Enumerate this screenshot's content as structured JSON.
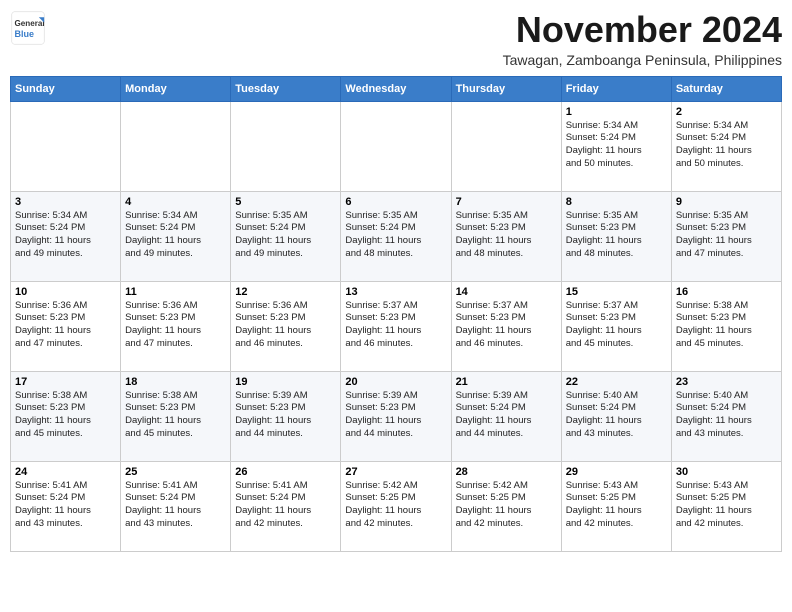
{
  "header": {
    "logo_line1": "General",
    "logo_line2": "Blue",
    "month": "November 2024",
    "location": "Tawagan, Zamboanga Peninsula, Philippines"
  },
  "weekdays": [
    "Sunday",
    "Monday",
    "Tuesday",
    "Wednesday",
    "Thursday",
    "Friday",
    "Saturday"
  ],
  "weeks": [
    [
      {
        "day": "",
        "info": ""
      },
      {
        "day": "",
        "info": ""
      },
      {
        "day": "",
        "info": ""
      },
      {
        "day": "",
        "info": ""
      },
      {
        "day": "",
        "info": ""
      },
      {
        "day": "1",
        "info": "Sunrise: 5:34 AM\nSunset: 5:24 PM\nDaylight: 11 hours\nand 50 minutes."
      },
      {
        "day": "2",
        "info": "Sunrise: 5:34 AM\nSunset: 5:24 PM\nDaylight: 11 hours\nand 50 minutes."
      }
    ],
    [
      {
        "day": "3",
        "info": "Sunrise: 5:34 AM\nSunset: 5:24 PM\nDaylight: 11 hours\nand 49 minutes."
      },
      {
        "day": "4",
        "info": "Sunrise: 5:34 AM\nSunset: 5:24 PM\nDaylight: 11 hours\nand 49 minutes."
      },
      {
        "day": "5",
        "info": "Sunrise: 5:35 AM\nSunset: 5:24 PM\nDaylight: 11 hours\nand 49 minutes."
      },
      {
        "day": "6",
        "info": "Sunrise: 5:35 AM\nSunset: 5:24 PM\nDaylight: 11 hours\nand 48 minutes."
      },
      {
        "day": "7",
        "info": "Sunrise: 5:35 AM\nSunset: 5:23 PM\nDaylight: 11 hours\nand 48 minutes."
      },
      {
        "day": "8",
        "info": "Sunrise: 5:35 AM\nSunset: 5:23 PM\nDaylight: 11 hours\nand 48 minutes."
      },
      {
        "day": "9",
        "info": "Sunrise: 5:35 AM\nSunset: 5:23 PM\nDaylight: 11 hours\nand 47 minutes."
      }
    ],
    [
      {
        "day": "10",
        "info": "Sunrise: 5:36 AM\nSunset: 5:23 PM\nDaylight: 11 hours\nand 47 minutes."
      },
      {
        "day": "11",
        "info": "Sunrise: 5:36 AM\nSunset: 5:23 PM\nDaylight: 11 hours\nand 47 minutes."
      },
      {
        "day": "12",
        "info": "Sunrise: 5:36 AM\nSunset: 5:23 PM\nDaylight: 11 hours\nand 46 minutes."
      },
      {
        "day": "13",
        "info": "Sunrise: 5:37 AM\nSunset: 5:23 PM\nDaylight: 11 hours\nand 46 minutes."
      },
      {
        "day": "14",
        "info": "Sunrise: 5:37 AM\nSunset: 5:23 PM\nDaylight: 11 hours\nand 46 minutes."
      },
      {
        "day": "15",
        "info": "Sunrise: 5:37 AM\nSunset: 5:23 PM\nDaylight: 11 hours\nand 45 minutes."
      },
      {
        "day": "16",
        "info": "Sunrise: 5:38 AM\nSunset: 5:23 PM\nDaylight: 11 hours\nand 45 minutes."
      }
    ],
    [
      {
        "day": "17",
        "info": "Sunrise: 5:38 AM\nSunset: 5:23 PM\nDaylight: 11 hours\nand 45 minutes."
      },
      {
        "day": "18",
        "info": "Sunrise: 5:38 AM\nSunset: 5:23 PM\nDaylight: 11 hours\nand 45 minutes."
      },
      {
        "day": "19",
        "info": "Sunrise: 5:39 AM\nSunset: 5:23 PM\nDaylight: 11 hours\nand 44 minutes."
      },
      {
        "day": "20",
        "info": "Sunrise: 5:39 AM\nSunset: 5:23 PM\nDaylight: 11 hours\nand 44 minutes."
      },
      {
        "day": "21",
        "info": "Sunrise: 5:39 AM\nSunset: 5:24 PM\nDaylight: 11 hours\nand 44 minutes."
      },
      {
        "day": "22",
        "info": "Sunrise: 5:40 AM\nSunset: 5:24 PM\nDaylight: 11 hours\nand 43 minutes."
      },
      {
        "day": "23",
        "info": "Sunrise: 5:40 AM\nSunset: 5:24 PM\nDaylight: 11 hours\nand 43 minutes."
      }
    ],
    [
      {
        "day": "24",
        "info": "Sunrise: 5:41 AM\nSunset: 5:24 PM\nDaylight: 11 hours\nand 43 minutes."
      },
      {
        "day": "25",
        "info": "Sunrise: 5:41 AM\nSunset: 5:24 PM\nDaylight: 11 hours\nand 43 minutes."
      },
      {
        "day": "26",
        "info": "Sunrise: 5:41 AM\nSunset: 5:24 PM\nDaylight: 11 hours\nand 42 minutes."
      },
      {
        "day": "27",
        "info": "Sunrise: 5:42 AM\nSunset: 5:25 PM\nDaylight: 11 hours\nand 42 minutes."
      },
      {
        "day": "28",
        "info": "Sunrise: 5:42 AM\nSunset: 5:25 PM\nDaylight: 11 hours\nand 42 minutes."
      },
      {
        "day": "29",
        "info": "Sunrise: 5:43 AM\nSunset: 5:25 PM\nDaylight: 11 hours\nand 42 minutes."
      },
      {
        "day": "30",
        "info": "Sunrise: 5:43 AM\nSunset: 5:25 PM\nDaylight: 11 hours\nand 42 minutes."
      }
    ]
  ]
}
